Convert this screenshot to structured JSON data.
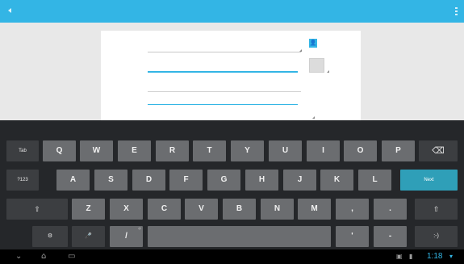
{
  "action_bar": {
    "back_label": "",
    "icons": [
      "back-icon",
      "overflow-menu-icon"
    ],
    "color": "#33b5e5"
  },
  "form": {
    "fields": [],
    "colors": {
      "focus_underline": "#33b5e5",
      "card": "#ffffff"
    }
  },
  "keyboard": {
    "row1": [
      "Tab",
      "Q",
      "W",
      "E",
      "R",
      "T",
      "Y",
      "U",
      "I",
      "O",
      "P",
      "⌫"
    ],
    "row2": [
      "?123",
      "A",
      "S",
      "D",
      "F",
      "G",
      "H",
      "J",
      "K",
      "L",
      "Next"
    ],
    "row3": [
      "⇧",
      "Z",
      "X",
      "C",
      "V",
      "B",
      "N",
      "M",
      ",",
      ".",
      "⇧"
    ],
    "row4": [
      "⚙",
      "🎤",
      "/",
      "",
      "'",
      "-",
      ":-)"
    ],
    "colors": {
      "background": "#25272a",
      "key": "#6b6d70",
      "action": "#2f9fb8"
    }
  },
  "nav": {
    "icons": [
      "hide-keyboard-icon",
      "home-icon",
      "recent-apps-icon",
      "screenshot-icon",
      "signal-icon"
    ],
    "clock": "1:18"
  }
}
